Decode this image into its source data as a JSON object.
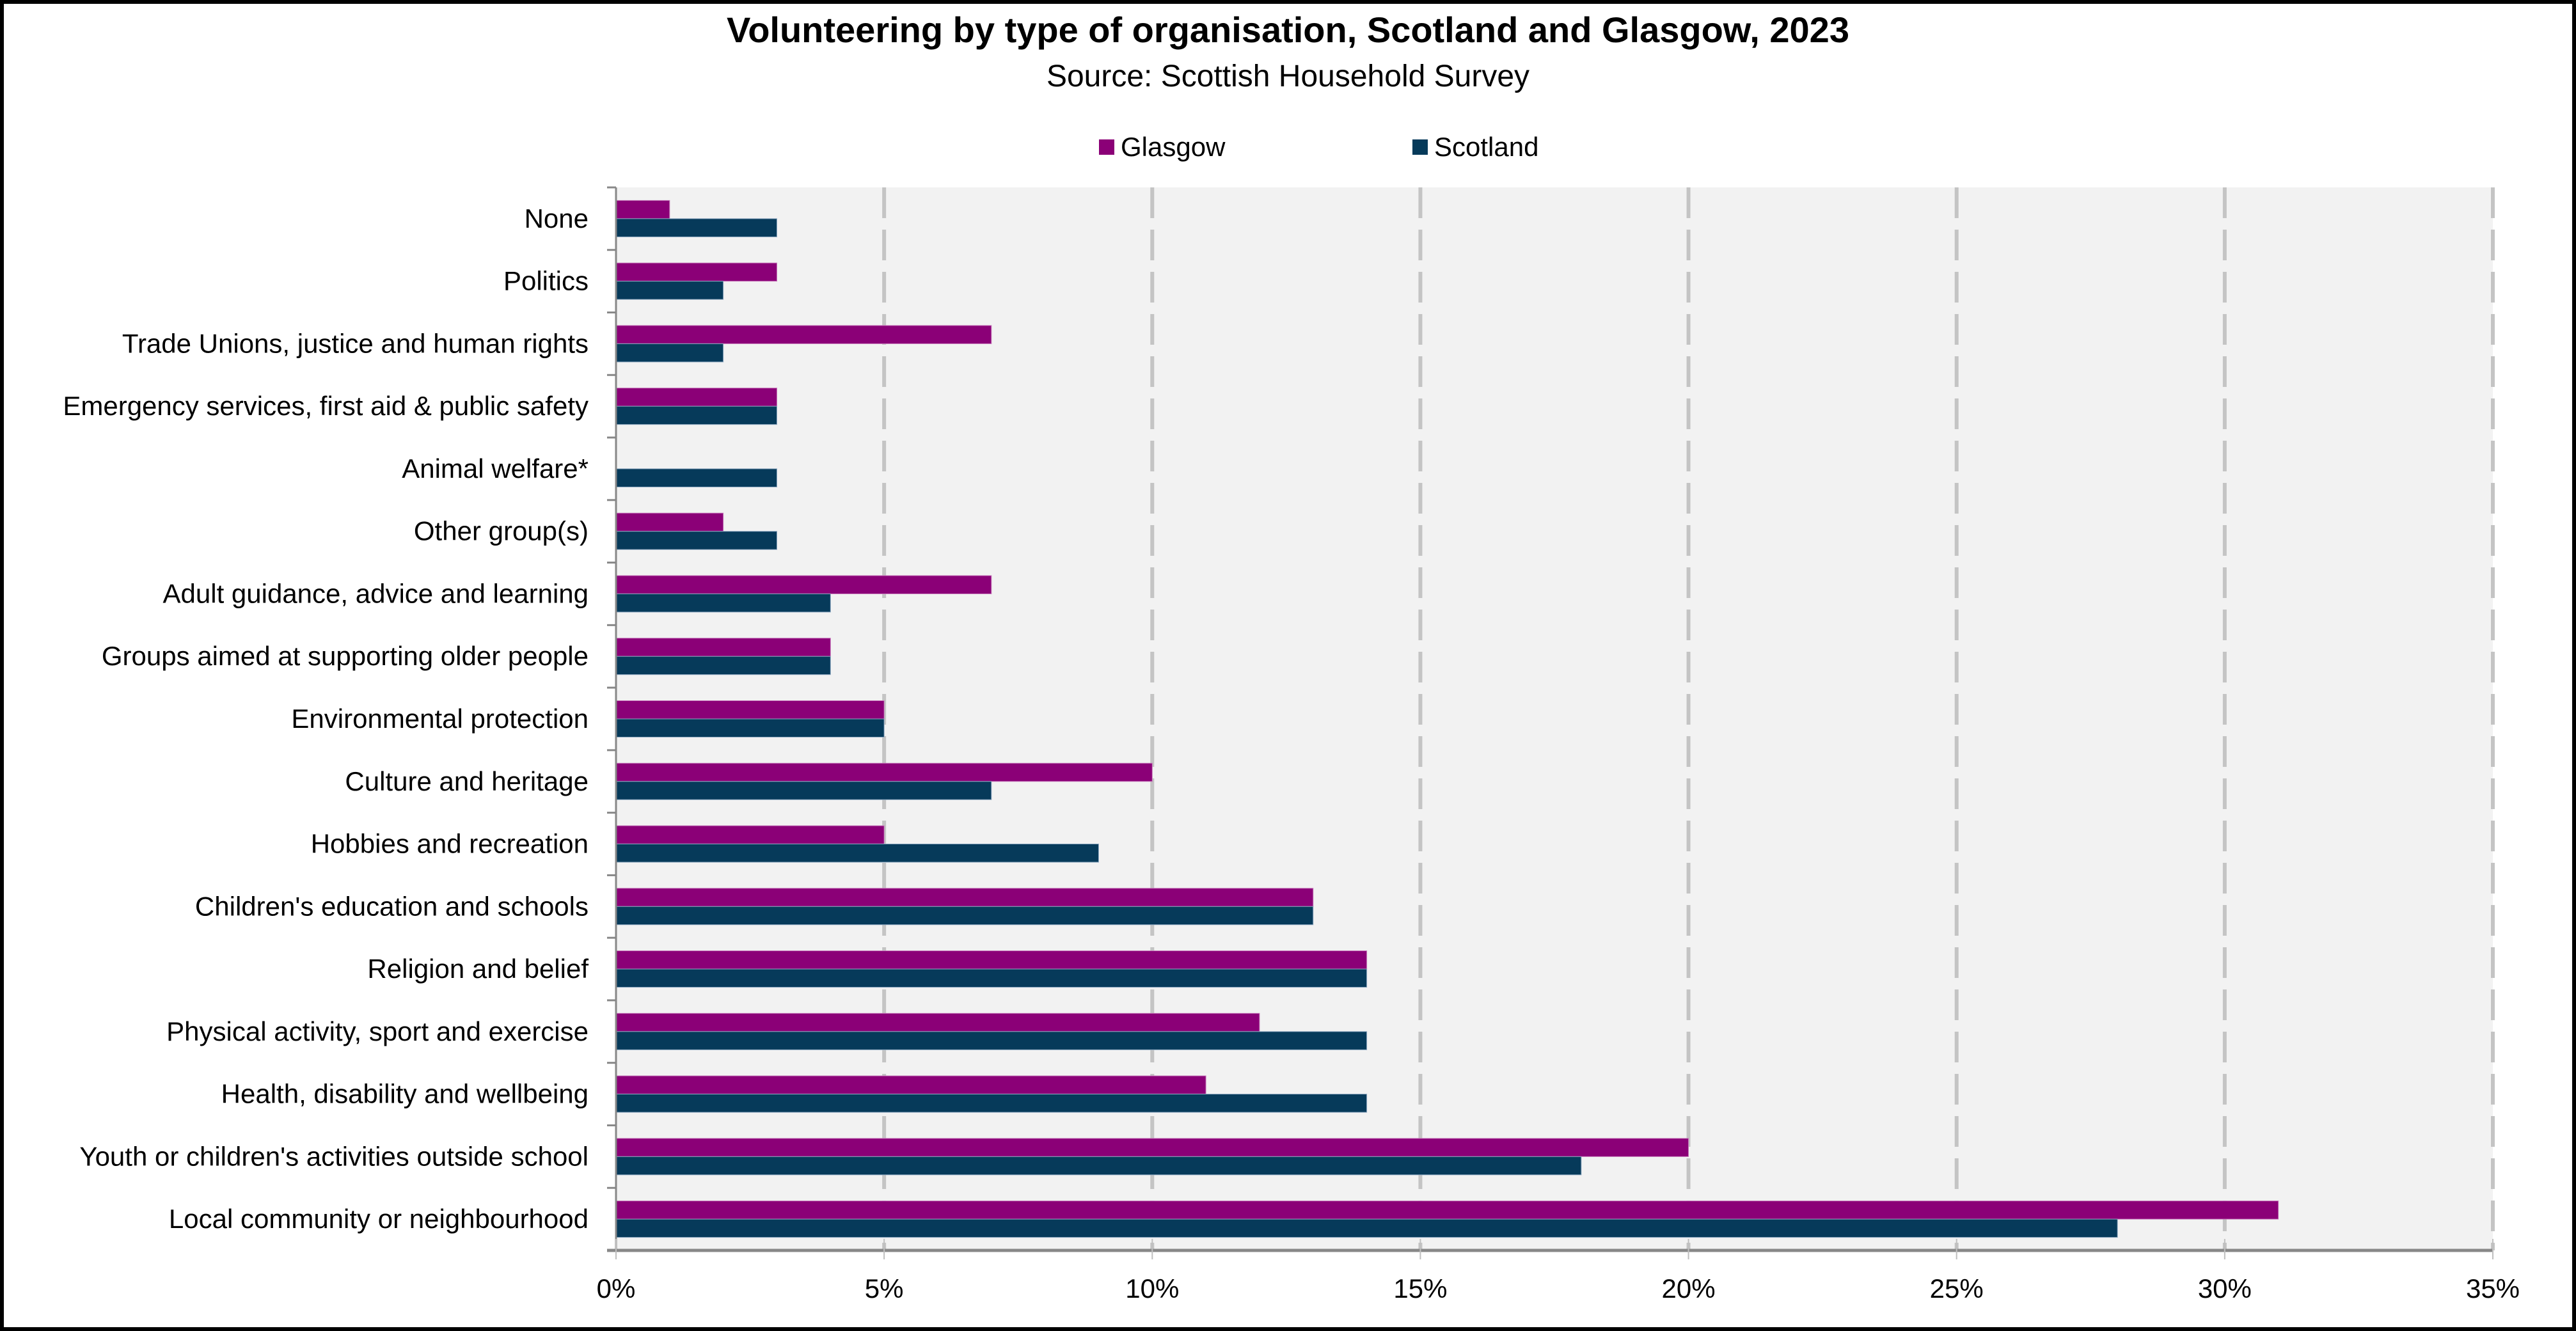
{
  "chart_data": {
    "type": "bar",
    "orientation": "horizontal",
    "title": "Volunteering by type of organisation, Scotland and Glasgow, 2023",
    "subtitle": "Source: Scottish Household Survey",
    "xlabel": "",
    "ylabel": "",
    "xlim": [
      0,
      35
    ],
    "x_ticks": [
      "0%",
      "5%",
      "10%",
      "15%",
      "20%",
      "25%",
      "30%",
      "35%"
    ],
    "x_tick_values": [
      0,
      5,
      10,
      15,
      20,
      25,
      30,
      35
    ],
    "grid": "vertical dashed",
    "legend_position": "top-center",
    "categories": [
      "None",
      "Politics",
      "Trade Unions, justice and human rights",
      "Emergency services, first aid & public safety",
      "Animal welfare*",
      "Other group(s)",
      "Adult guidance, advice and learning",
      "Groups aimed at supporting older people",
      "Environmental protection",
      "Culture and heritage",
      "Hobbies and recreation",
      "Children's education and schools",
      "Religion and belief",
      "Physical activity, sport and exercise",
      "Health, disability and wellbeing",
      "Youth or children's activities outside school",
      "Local community or neighbourhood"
    ],
    "series": [
      {
        "name": "Glasgow",
        "color": "#8B0077",
        "values": [
          1,
          3,
          7,
          3,
          null,
          2,
          7,
          4,
          5,
          10,
          5,
          13,
          14,
          12,
          11,
          20,
          31
        ]
      },
      {
        "name": "Scotland",
        "color": "#063A5A",
        "values": [
          3,
          2,
          2,
          3,
          3,
          3,
          4,
          4,
          5,
          7,
          9,
          13,
          14,
          14,
          14,
          18,
          28
        ]
      }
    ],
    "unit": "%"
  },
  "colors": {
    "plot_background": "#F2F2F2",
    "gridline": "#C4C4C4",
    "axis": "#888888"
  }
}
